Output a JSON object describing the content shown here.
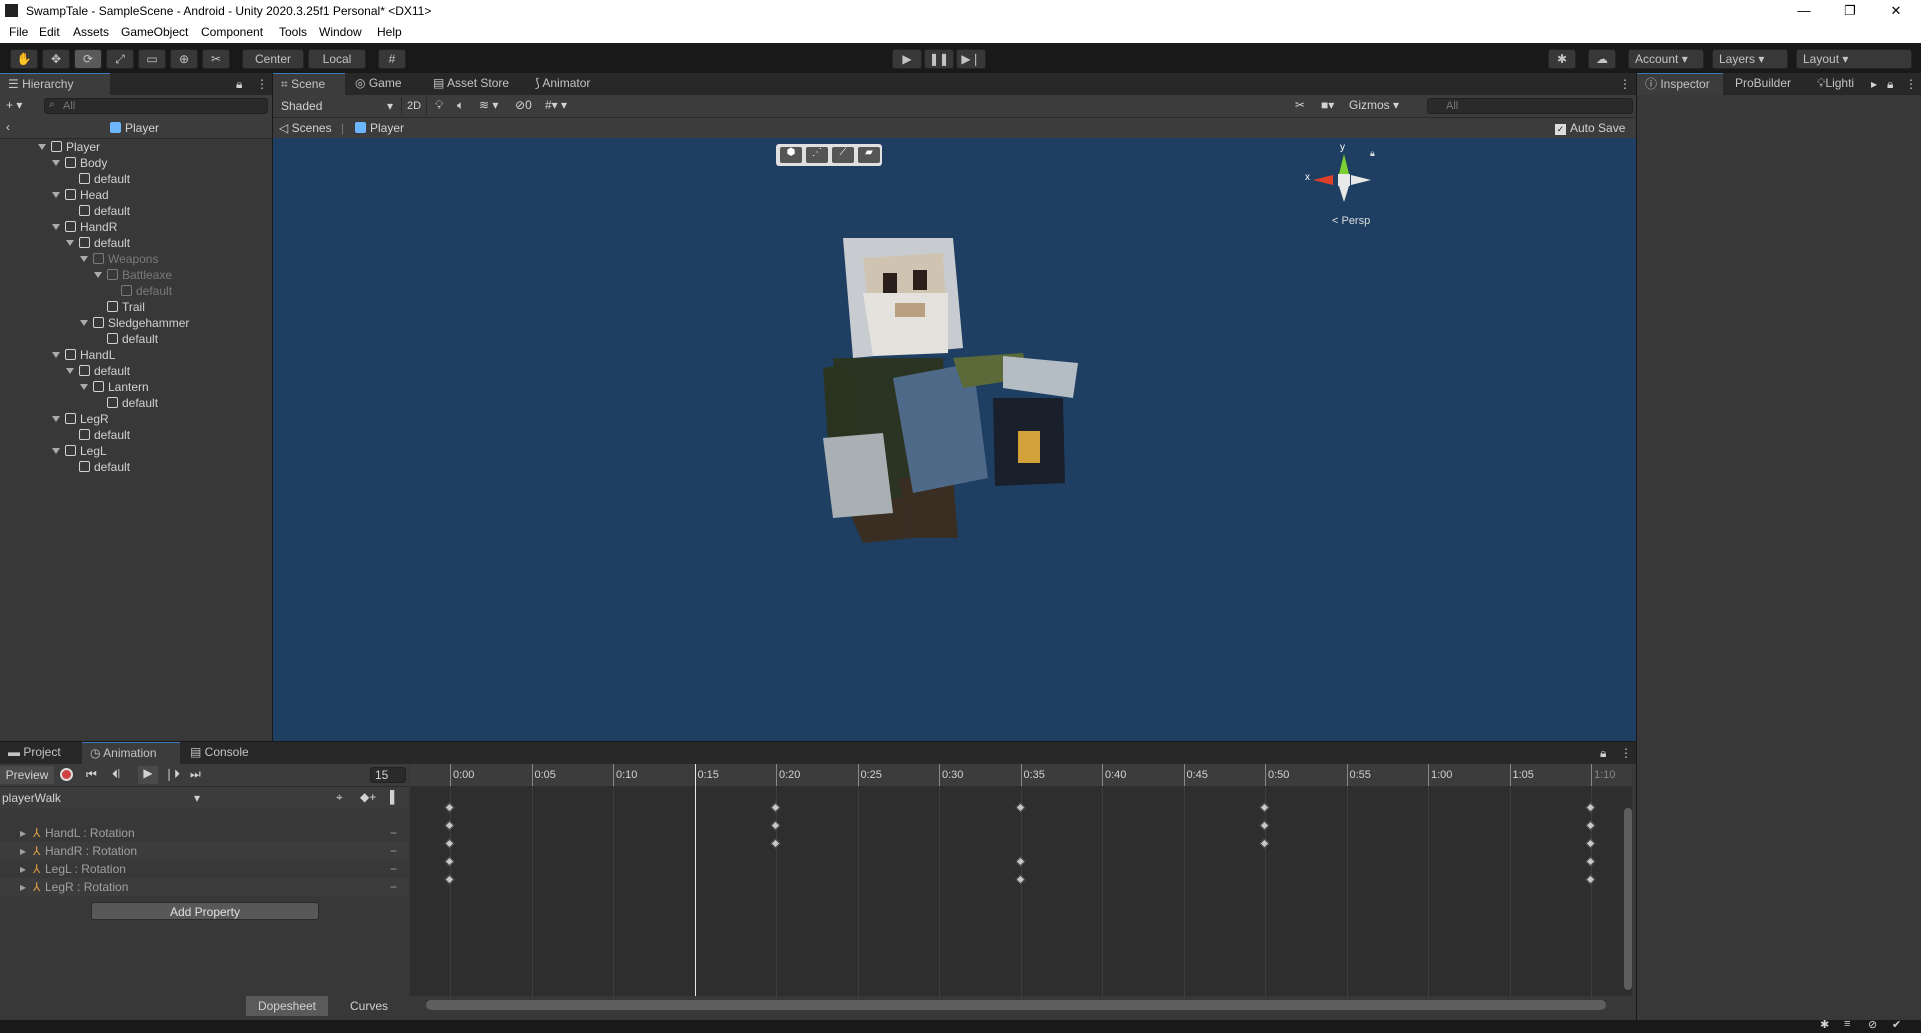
{
  "window": {
    "title": "SwampTale - SampleScene - Android - Unity 2020.3.25f1 Personal* <DX11>",
    "minimize": "—",
    "maximize": "❐",
    "close": "✕"
  },
  "menu": [
    "File",
    "Edit",
    "Assets",
    "GameObject",
    "Component",
    "Tools",
    "Window",
    "Help"
  ],
  "toolbar": {
    "pivot": "Center",
    "space": "Local",
    "account": "Account",
    "layers": "Layers",
    "layout": "Layout"
  },
  "hierarchy": {
    "tab": "Hierarchy",
    "search_placeholder": "All",
    "breadcrumb": "Player",
    "items": [
      {
        "label": "Player",
        "depth": 0,
        "expanded": true
      },
      {
        "label": "Body",
        "depth": 1,
        "expanded": true
      },
      {
        "label": "default",
        "depth": 2
      },
      {
        "label": "Head",
        "depth": 1,
        "expanded": true
      },
      {
        "label": "default",
        "depth": 2
      },
      {
        "label": "HandR",
        "depth": 1,
        "expanded": true
      },
      {
        "label": "default",
        "depth": 2,
        "expanded": true
      },
      {
        "label": "Weapons",
        "depth": 3,
        "expanded": true,
        "dim": true
      },
      {
        "label": "Battleaxe",
        "depth": 4,
        "expanded": true,
        "dim": true
      },
      {
        "label": "default",
        "depth": 5,
        "dim": true
      },
      {
        "label": "Trail",
        "depth": 4
      },
      {
        "label": "Sledgehammer",
        "depth": 3,
        "expanded": true
      },
      {
        "label": "default",
        "depth": 4
      },
      {
        "label": "HandL",
        "depth": 1,
        "expanded": true
      },
      {
        "label": "default",
        "depth": 2,
        "expanded": true
      },
      {
        "label": "Lantern",
        "depth": 3,
        "expanded": true
      },
      {
        "label": "default",
        "depth": 4
      },
      {
        "label": "LegR",
        "depth": 1,
        "expanded": true
      },
      {
        "label": "default",
        "depth": 2
      },
      {
        "label": "LegL",
        "depth": 1,
        "expanded": true
      },
      {
        "label": "default",
        "depth": 2
      }
    ]
  },
  "scene": {
    "tabs": [
      "Scene",
      "Game",
      "Asset Store",
      "Animator"
    ],
    "draw_mode": "Shaded",
    "mode_2d": "2D",
    "hidden_count": "0",
    "gizmos": "Gizmos",
    "search_placeholder": "All",
    "breadcrumb_root": "Scenes",
    "breadcrumb_current": "Player",
    "auto_save": "Auto Save",
    "gizmo_x": "x",
    "gizmo_y": "y",
    "persp": "< Persp"
  },
  "inspector": {
    "tabs": [
      "Inspector",
      "ProBuilder",
      "Lighti"
    ]
  },
  "animation": {
    "tabs": [
      "Project",
      "Animation",
      "Console"
    ],
    "preview": "Preview",
    "frame": "15",
    "clip": "playerWalk",
    "timeline_labels": [
      "0:00",
      "0:05",
      "0:10",
      "0:15",
      "0:20",
      "0:25",
      "0:30",
      "0:35",
      "0:40",
      "0:45",
      "0:50",
      "0:55",
      "1:00",
      "1:05",
      "1:10"
    ],
    "properties": [
      "HandL : Rotation",
      "HandR : Rotation",
      "LegL : Rotation",
      "LegR : Rotation"
    ],
    "add_property": "Add Property",
    "dopesheet": "Dopesheet",
    "curves": "Curves",
    "keyframe_times": {
      "summary": [
        "0:00",
        "0:20",
        "0:35",
        "0:50",
        "1:10"
      ],
      "HandL : Rotation": [
        "0:00",
        "0:20",
        "0:50",
        "1:10"
      ],
      "HandR : Rotation": [
        "0:00",
        "0:20",
        "0:50",
        "1:10"
      ],
      "LegL : Rotation": [
        "0:00",
        "0:35",
        "1:10"
      ],
      "LegR : Rotation": [
        "0:00",
        "0:35",
        "1:10"
      ]
    },
    "playhead": "0:15"
  }
}
